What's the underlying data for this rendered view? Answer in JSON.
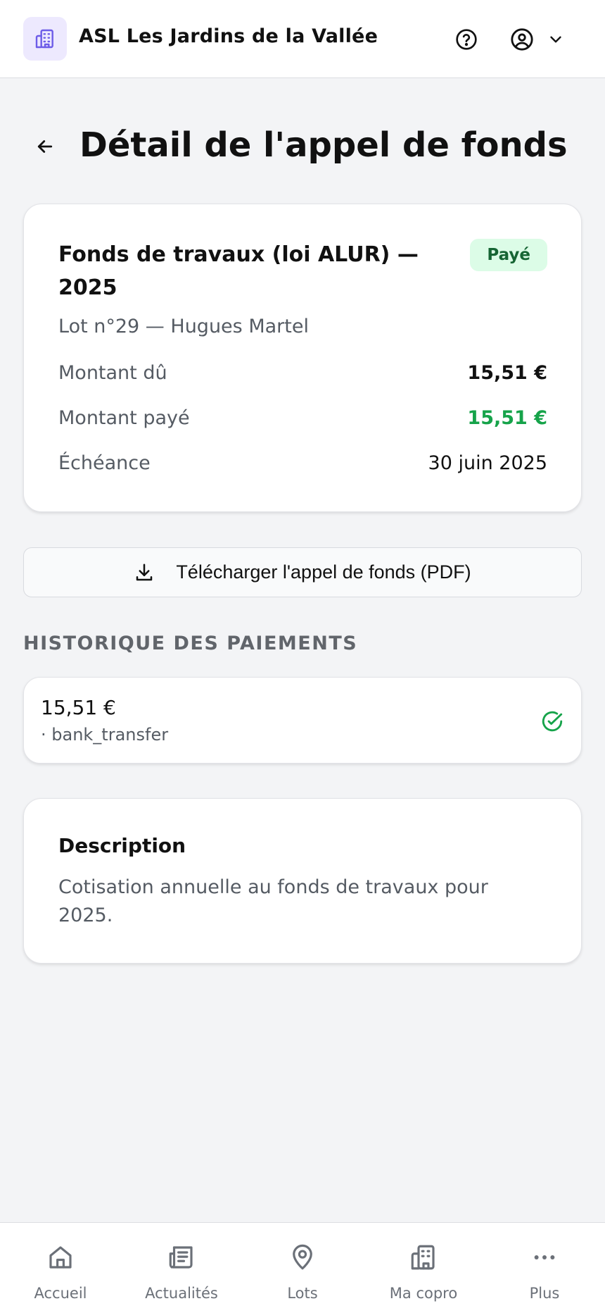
{
  "header": {
    "app_title": "ASL Les Jardins de la Vallée",
    "logo_icon": "building-icon",
    "help_icon": "help-circle-icon",
    "account_icon": "user-circle-icon",
    "account_chevron_icon": "chevron-down-icon",
    "logo_bg": "#ede9fe",
    "logo_color": "#6d5ce8"
  },
  "page": {
    "back_icon": "arrow-left-icon",
    "title": "Détail de l'appel de fonds"
  },
  "call": {
    "title": "Fonds de travaux (loi ALUR) — 2025",
    "status": "Payé",
    "status_bg": "#dcfce7",
    "status_color": "#166534",
    "lot_info": "Lot n°29 — Hugues Martel",
    "due_label": "Montant dû",
    "due_value": "15,51 €",
    "paid_label": "Montant payé",
    "paid_value": "15,51 €",
    "paid_color": "#16a34a",
    "deadline_label": "Échéance",
    "deadline_value": "30 juin 2025"
  },
  "download": {
    "label": "Télécharger l'appel de fonds (PDF)",
    "icon": "download-icon"
  },
  "payments": {
    "heading": "HISTORIQUE DES PAIEMENTS",
    "items": [
      {
        "amount": "15,51 €",
        "method": "· bank_transfer",
        "status_icon": "check-circle-icon"
      }
    ]
  },
  "description": {
    "title": "Description",
    "text": "Cotisation annuelle au fonds de travaux pour 2025."
  },
  "bottom_nav": {
    "items": [
      {
        "label": "Accueil",
        "icon": "home-icon"
      },
      {
        "label": "Actualités",
        "icon": "newspaper-icon"
      },
      {
        "label": "Lots",
        "icon": "map-pin-icon"
      },
      {
        "label": "Ma copro",
        "icon": "building-icon"
      },
      {
        "label": "Plus",
        "icon": "more-horizontal-icon"
      }
    ]
  }
}
